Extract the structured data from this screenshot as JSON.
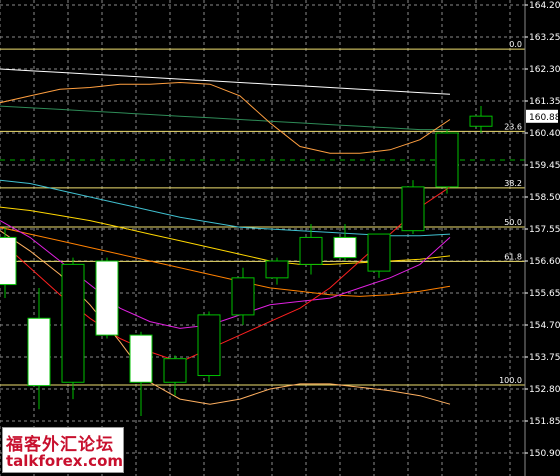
{
  "chart_data": {
    "type": "candlestick",
    "y_axis": {
      "ticks": [
        "164.20",
        "163.25",
        "162.30",
        "161.35",
        "160.40",
        "159.45",
        "158.50",
        "157.55",
        "156.60",
        "155.65",
        "154.70",
        "153.75",
        "152.80",
        "151.85",
        "150.90"
      ],
      "ylim": [
        150.9,
        164.2
      ],
      "position": "right"
    },
    "current_price": "160.88",
    "grid": true,
    "fib_levels": [
      {
        "label": "0.0",
        "value": 162.89
      },
      {
        "label": "23.6",
        "value": 160.45
      },
      {
        "label": "38.2",
        "value": 158.77
      },
      {
        "label": "50.0",
        "value": 157.61
      },
      {
        "label": "61.8",
        "value": 156.59
      },
      {
        "label": "100.0",
        "value": 152.92
      }
    ],
    "candles": [
      {
        "open": 157.3,
        "high": 157.6,
        "low": 155.5,
        "close": 155.9
      },
      {
        "open": 154.9,
        "high": 155.8,
        "low": 152.2,
        "close": 152.9
      },
      {
        "open": 153.0,
        "high": 156.7,
        "low": 152.5,
        "close": 156.5
      },
      {
        "open": 156.6,
        "high": 156.7,
        "low": 154.3,
        "close": 154.4
      },
      {
        "open": 154.4,
        "high": 154.5,
        "low": 152.0,
        "close": 153.0
      },
      {
        "open": 153.0,
        "high": 153.8,
        "low": 152.6,
        "close": 153.7
      },
      {
        "open": 153.2,
        "high": 155.1,
        "low": 153.0,
        "close": 155.0
      },
      {
        "open": 155.0,
        "high": 156.4,
        "low": 154.7,
        "close": 156.1
      },
      {
        "open": 156.1,
        "high": 156.7,
        "low": 155.9,
        "close": 156.6
      },
      {
        "open": 156.5,
        "high": 157.7,
        "low": 156.2,
        "close": 157.3
      },
      {
        "open": 157.3,
        "high": 157.7,
        "low": 156.6,
        "close": 156.7
      },
      {
        "open": 156.3,
        "high": 157.4,
        "low": 156.1,
        "close": 157.4
      },
      {
        "open": 157.5,
        "high": 159.0,
        "low": 157.4,
        "close": 158.8
      },
      {
        "open": 158.8,
        "high": 160.5,
        "low": 158.6,
        "close": 160.4
      },
      {
        "open": 160.6,
        "high": 161.2,
        "low": 160.4,
        "close": 160.9
      }
    ],
    "series": [
      {
        "color": "#ffffff",
        "values": [
          162.3,
          162.25,
          162.2,
          162.15,
          162.1,
          162.05,
          162.0,
          161.95,
          161.9,
          161.85,
          161.8,
          161.75,
          161.7,
          161.65,
          161.6,
          161.55
        ]
      },
      {
        "color": "#2e8b57",
        "values": [
          161.2,
          161.15,
          161.1,
          161.05,
          161.0,
          160.95,
          160.9,
          160.85,
          160.8,
          160.75,
          160.7,
          160.65,
          160.6,
          160.55,
          160.5,
          160.5
        ]
      },
      {
        "color": "#ff9f40",
        "values": [
          161.3,
          161.5,
          161.7,
          161.75,
          161.85,
          161.85,
          161.9,
          161.85,
          161.5,
          160.7,
          160.0,
          159.8,
          159.8,
          159.9,
          160.2,
          160.8
        ]
      },
      {
        "color": "#40c0d0",
        "values": [
          159.0,
          158.9,
          158.7,
          158.5,
          158.3,
          158.1,
          157.9,
          157.75,
          157.6,
          157.55,
          157.5,
          157.45,
          157.4,
          157.35,
          157.35,
          157.4
        ]
      },
      {
        "color": "#ffd700",
        "values": [
          158.2,
          158.1,
          157.95,
          157.8,
          157.6,
          157.4,
          157.2,
          157.0,
          156.8,
          156.6,
          156.5,
          156.5,
          156.55,
          156.6,
          156.65,
          156.75
        ]
      },
      {
        "color": "#ff8000",
        "values": [
          157.6,
          157.4,
          157.2,
          157.0,
          156.8,
          156.6,
          156.4,
          156.2,
          156.0,
          155.8,
          155.7,
          155.6,
          155.55,
          155.6,
          155.7,
          155.85
        ]
      },
      {
        "color": "#e020e0",
        "values": [
          157.8,
          157.3,
          156.6,
          155.9,
          155.2,
          154.8,
          154.6,
          154.7,
          155.0,
          155.3,
          155.4,
          155.5,
          155.8,
          156.1,
          156.5,
          157.3
        ]
      },
      {
        "color": "#ff2020",
        "values": [
          157.2,
          156.4,
          155.6,
          154.9,
          154.3,
          153.9,
          153.6,
          154.0,
          154.4,
          154.8,
          155.2,
          155.8,
          156.6,
          157.4,
          158.2,
          158.8
        ]
      },
      {
        "color": "#ffb060",
        "values": [
          157.5,
          156.9,
          156.2,
          155.3,
          154.2,
          153.0,
          152.5,
          152.35,
          152.5,
          152.8,
          152.95,
          152.95,
          152.85,
          152.75,
          152.6,
          152.35
        ]
      }
    ]
  },
  "watermark": {
    "line1": "福客外汇论坛",
    "line2": "talkforex.com"
  }
}
